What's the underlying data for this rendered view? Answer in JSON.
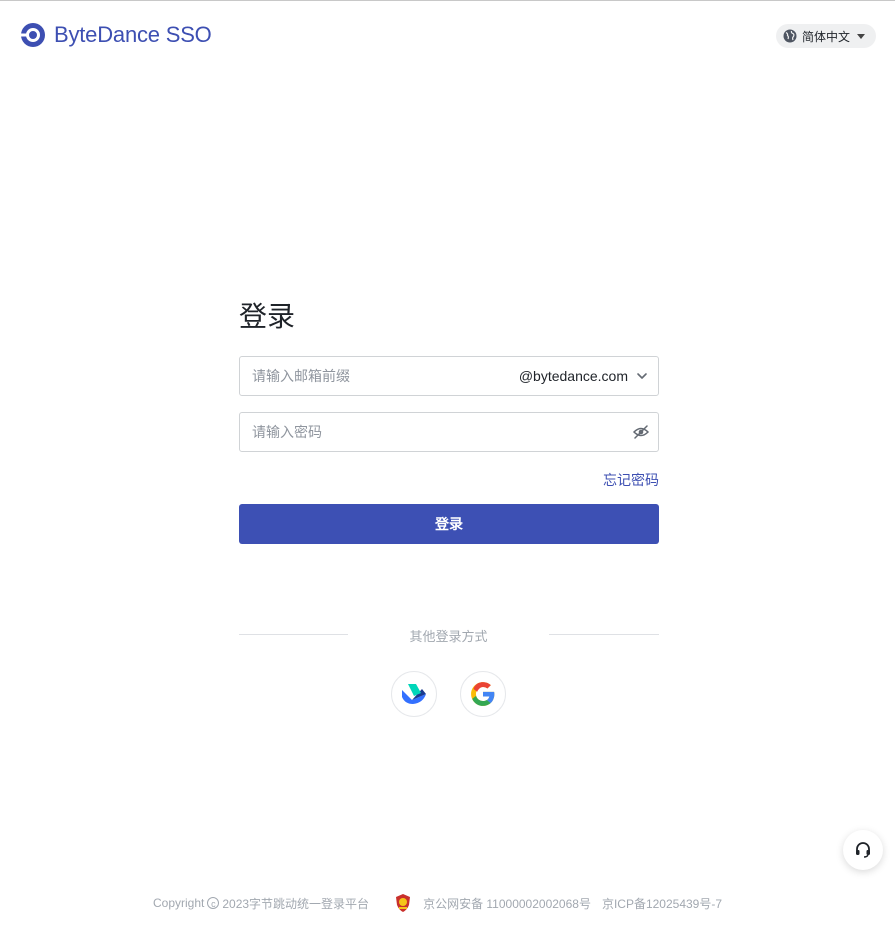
{
  "header": {
    "brand": "ByteDance SSO",
    "language": "简体中文"
  },
  "login": {
    "title": "登录",
    "email_placeholder": "请输入邮箱前缀",
    "email_value": "",
    "email_domain": "@bytedance.com",
    "password_placeholder": "请输入密码",
    "password_value": "",
    "forgot_password": "忘记密码",
    "submit_label": "登录"
  },
  "other_login": {
    "label": "其他登录方式",
    "providers": [
      {
        "icon": "lark-icon"
      },
      {
        "icon": "google-icon"
      }
    ]
  },
  "footer": {
    "copyright_prefix": "Copyright",
    "copyright_symbol": "c",
    "copyright_text": "2023字节跳动统一登录平台",
    "public_security": "京公网安备 11000002002068号",
    "icp": "京ICP备12025439号-7"
  },
  "colors": {
    "accent": "#3d50b4",
    "link": "#3d4fb2",
    "muted_text": "#a2a8b0",
    "border": "#d0d3d6"
  }
}
